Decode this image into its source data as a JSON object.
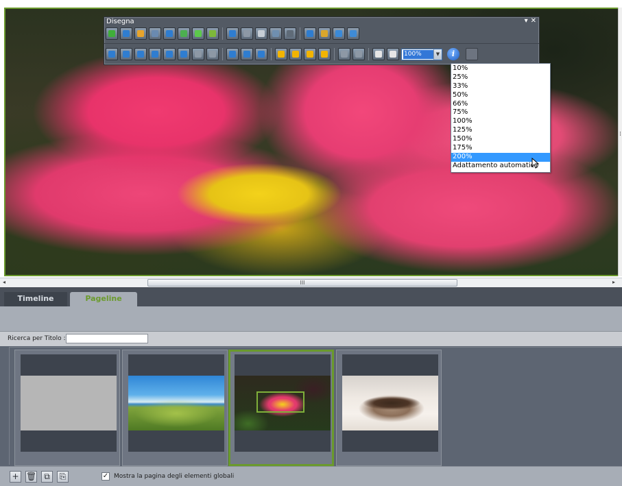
{
  "toolbar": {
    "title": "Disegna",
    "controls": {
      "pin": "▾",
      "close": "✕"
    },
    "row1_icon_colors": [
      "#3fae3a",
      "#2f7dd0",
      "#e8a42b",
      "#6a8ab0",
      "#2f7dd0",
      "#4caf50",
      "#5cc94b",
      "#7db83a",
      "#2f7dd0",
      "#8d98a5",
      "#c7ced6",
      "#6f8fb0",
      "#5f6b78",
      "#2f7dd0",
      "#d9a62c",
      "#3b8ad8",
      "#3f8bd6"
    ],
    "row2_icon_colors": [
      "#2f7dd0",
      "#2f7dd0",
      "#2f7dd0",
      "#2f7dd0",
      "#2f7dd0",
      "#2f7dd0",
      "#8d98a5",
      "#8d98a5",
      "#2f7dd0",
      "#2f7dd0",
      "#2f7dd0",
      "#f2b400",
      "#f2b400",
      "#f2b400",
      "#f2b400",
      "#8d98a5",
      "#8d98a5",
      "#e6e6e6",
      "#e6e6e6"
    ],
    "zoom_value": "100%",
    "info_label": "i"
  },
  "zoom_options": [
    "10%",
    "25%",
    "33%",
    "50%",
    "66%",
    "75%",
    "100%",
    "125%",
    "150%",
    "175%",
    "200%",
    "Adattamento automatico"
  ],
  "zoom_selected": "200%",
  "scrollbar": {
    "left_arrow": "◂",
    "right_arrow": "▸",
    "thumb_grip": "III"
  },
  "tabs": {
    "timeline": "Timeline",
    "pageline": "Pageline"
  },
  "search": {
    "label": "Ricerca per Titolo :",
    "value": ""
  },
  "pages": [
    {
      "name": "blank",
      "image": "blank"
    },
    {
      "name": "landscape",
      "image": "land"
    },
    {
      "name": "flower",
      "image": "flower"
    },
    {
      "name": "cup",
      "image": "cup"
    }
  ],
  "active_page": 2,
  "bottom": {
    "buttons": [
      "+",
      "🗑",
      "⧉",
      "⎘"
    ],
    "checkbox_checked": true,
    "checkbox_mark": "✓",
    "checkbox_label": "Mostra la pagina degli elementi globali"
  },
  "colors": {
    "accent_green": "#6a9a2c",
    "selection_blue": "#3399ff"
  }
}
